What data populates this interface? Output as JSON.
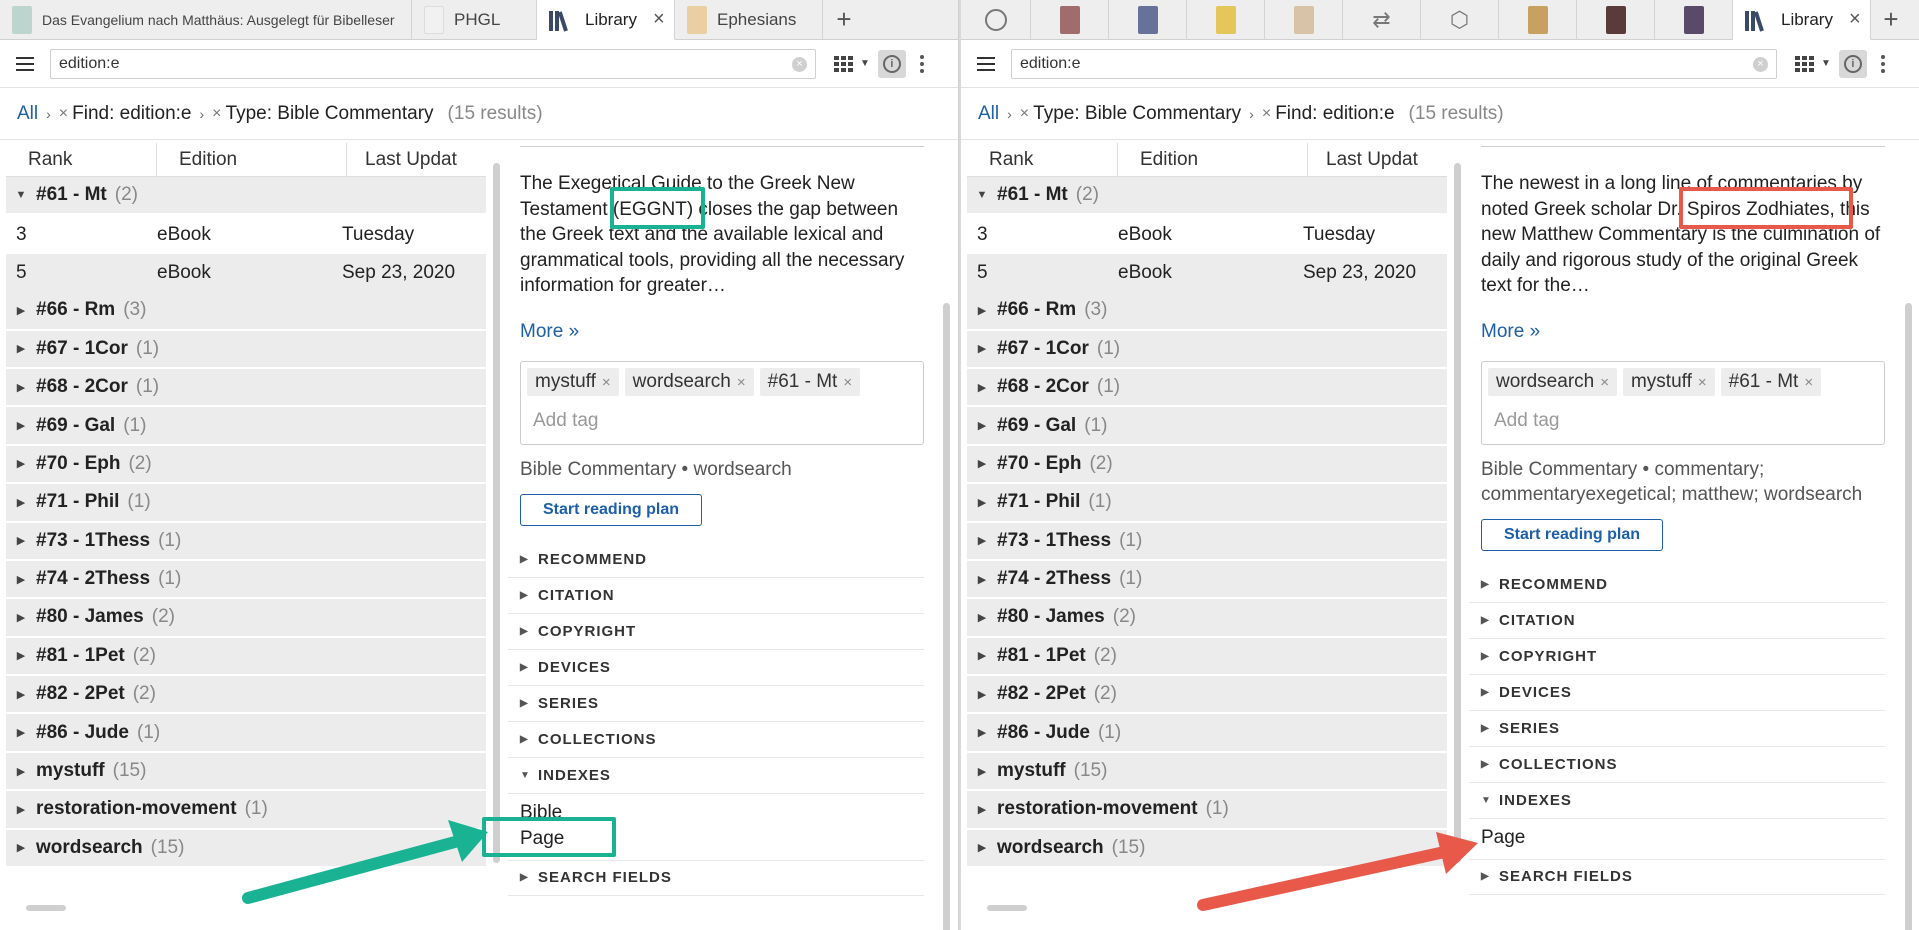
{
  "left": {
    "tabs": [
      {
        "label": "Das Evangelium nach Matthäus: Ausgelegt für Bibelleser"
      },
      {
        "label": "PHGL"
      },
      {
        "label": "Library"
      },
      {
        "label": "Ephesians"
      }
    ],
    "search": {
      "value": "edition:e"
    },
    "breadcrumb": {
      "all": "All",
      "crumb1": "Find: edition:e",
      "crumb2": "Type: Bible Commentary",
      "count": "(15 results)"
    },
    "columns": [
      "Rank",
      "Edition",
      "Last Updat"
    ],
    "rows": [
      {
        "name": "#61 - Mt",
        "count": "(2)",
        "open": true
      },
      {
        "rank": "3",
        "edition": "eBook",
        "updated": "Tuesday"
      },
      {
        "rank": "5",
        "edition": "eBook",
        "updated": "Sep 23, 2020"
      },
      {
        "name": "#66 - Rm",
        "count": "(3)"
      },
      {
        "name": "#67 - 1Cor",
        "count": "(1)"
      },
      {
        "name": "#68 - 2Cor",
        "count": "(1)"
      },
      {
        "name": "#69 - Gal",
        "count": "(1)"
      },
      {
        "name": "#70 - Eph",
        "count": "(2)"
      },
      {
        "name": "#71 - Phil",
        "count": "(1)"
      },
      {
        "name": "#73 - 1Thess",
        "count": "(1)"
      },
      {
        "name": "#74 - 2Thess",
        "count": "(1)"
      },
      {
        "name": "#80 - James",
        "count": "(2)"
      },
      {
        "name": "#81 - 1Pet",
        "count": "(2)"
      },
      {
        "name": "#82 - 2Pet",
        "count": "(2)"
      },
      {
        "name": "#86 - Jude",
        "count": "(1)"
      },
      {
        "name": "mystuff",
        "count": "(15)"
      },
      {
        "name": "restoration-movement",
        "count": "(1)"
      },
      {
        "name": "wordsearch",
        "count": "(15)"
      }
    ],
    "detail": {
      "description": "The Exegetical Guide to the Greek New Testament (EGGNT) closes the gap between the Greek text and the available lexical and grammatical tools, providing all the necessary information for greater…",
      "more": "More »",
      "tags": [
        "mystuff",
        "wordsearch",
        "#61 - Mt"
      ],
      "add_tag": "Add tag",
      "meta": "Bible Commentary • wordsearch",
      "plan_button": "Start reading plan",
      "sections": [
        "RECOMMEND",
        "CITATION",
        "COPYRIGHT",
        "DEVICES",
        "SERIES",
        "COLLECTIONS",
        "INDEXES"
      ],
      "indexes": [
        "Bible",
        "Page"
      ],
      "last_section": "SEARCH FIELDS"
    }
  },
  "right": {
    "tabs": [
      {
        "label": "Library"
      }
    ],
    "search": {
      "value": "edition:e"
    },
    "breadcrumb": {
      "all": "All",
      "crumb1": "Type: Bible Commentary",
      "crumb2": "Find: edition:e",
      "count": "(15 results)"
    },
    "columns": [
      "Rank",
      "Edition",
      "Last Updat"
    ],
    "rows": [
      {
        "name": "#61 - Mt",
        "count": "(2)",
        "open": true
      },
      {
        "rank": "3",
        "edition": "eBook",
        "updated": "Tuesday"
      },
      {
        "rank": "5",
        "edition": "eBook",
        "updated": "Sep 23, 2020"
      },
      {
        "name": "#66 - Rm",
        "count": "(3)"
      },
      {
        "name": "#67 - 1Cor",
        "count": "(1)"
      },
      {
        "name": "#68 - 2Cor",
        "count": "(1)"
      },
      {
        "name": "#69 - Gal",
        "count": "(1)"
      },
      {
        "name": "#70 - Eph",
        "count": "(2)"
      },
      {
        "name": "#71 - Phil",
        "count": "(1)"
      },
      {
        "name": "#73 - 1Thess",
        "count": "(1)"
      },
      {
        "name": "#74 - 2Thess",
        "count": "(1)"
      },
      {
        "name": "#80 - James",
        "count": "(2)"
      },
      {
        "name": "#81 - 1Pet",
        "count": "(2)"
      },
      {
        "name": "#82 - 2Pet",
        "count": "(2)"
      },
      {
        "name": "#86 - Jude",
        "count": "(1)"
      },
      {
        "name": "mystuff",
        "count": "(15)"
      },
      {
        "name": "restoration-movement",
        "count": "(1)"
      },
      {
        "name": "wordsearch",
        "count": "(15)"
      }
    ],
    "detail": {
      "description": "The newest in a long line of commentaries by noted Greek scholar Dr. Spiros Zodhiates, this new Matthew Commentary is the culmination of daily and rigorous study of the original Greek text for the…",
      "more": "More »",
      "tags": [
        "wordsearch",
        "mystuff",
        "#61 - Mt"
      ],
      "add_tag": "Add tag",
      "meta": "Bible Commentary • commentary; commentaryexegetical; matthew; wordsearch",
      "plan_button": "Start reading plan",
      "sections": [
        "RECOMMEND",
        "CITATION",
        "COPYRIGHT",
        "DEVICES",
        "SERIES",
        "COLLECTIONS",
        "INDEXES"
      ],
      "indexes": [
        "Page"
      ],
      "last_section": "SEARCH FIELDS"
    }
  },
  "colors": {
    "link": "#1d5fa8",
    "green_annotation": "#19b394",
    "red_annotation": "#e8594a"
  },
  "icons": {
    "tab_close": "×",
    "add_tab": "+",
    "tag_remove": "×",
    "crumb_remove": "×",
    "collapsed": "▶",
    "expanded": "▼"
  }
}
